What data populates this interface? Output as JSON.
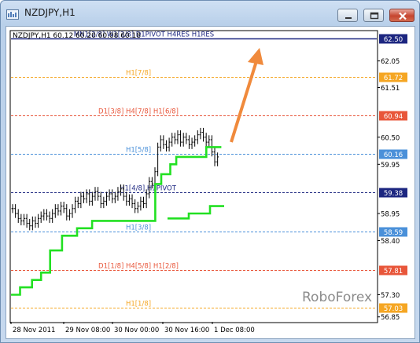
{
  "window": {
    "title": "NZDJPY,H1",
    "icon": "chart-bars-icon",
    "controls": [
      "minimize-icon",
      "maximize-icon",
      "close-icon"
    ]
  },
  "chart": {
    "info_line": "NZDJPY,H1  60.12 60.20 60.08 60.18",
    "watermark": "RoboForex",
    "y_ticks": [
      "62.05",
      "61.51",
      "60.50",
      "59.95",
      "58.95",
      "58.40",
      "57.30",
      "56.85"
    ],
    "x_ticks": [
      "28 Nov 2011",
      "29 Nov 08:00",
      "30 Nov 00:00",
      "30 Nov 16:00",
      "1 Dec 08:00"
    ]
  },
  "colors": {
    "orange_level": "#f5a623",
    "red_level": "#e8563a",
    "blue_level": "#4a90d9",
    "navy_level": "#1c2680",
    "indicator_line": "#22e022",
    "arrow": "#f08a3c"
  },
  "chart_data": {
    "type": "line",
    "title": "",
    "xlabel": "",
    "ylabel": "",
    "ylim": [
      56.75,
      62.65
    ],
    "x": [
      "28 Nov 2011",
      "29 Nov 08:00",
      "30 Nov 00:00",
      "30 Nov 16:00",
      "1 Dec 08:00"
    ],
    "levels": [
      {
        "label": "MN1[2/8] W1[2/8] D1PIVOT H4RES H1RES",
        "value": 62.5,
        "price_label": "62.50",
        "color": "#1c2680",
        "style": "solid"
      },
      {
        "label": "H1[7/8]",
        "value": 61.72,
        "price_label": "61.72",
        "color": "#f5a623",
        "style": "dashed"
      },
      {
        "label": "D1[3/8] H4[7/8] H1[6/8]",
        "value": 60.94,
        "price_label": "60.94",
        "color": "#e8563a",
        "style": "dashed"
      },
      {
        "label": "H1[5/8]",
        "value": 60.16,
        "price_label": "60.16",
        "color": "#4a90d9",
        "style": "dashed"
      },
      {
        "label": "H1[4/8] H1PIVOT",
        "value": 59.38,
        "price_label": "59.38",
        "color": "#1c2680",
        "style": "dashed"
      },
      {
        "label": "H1[3/8]",
        "value": 58.59,
        "price_label": "58.59",
        "color": "#4a90d9",
        "style": "dashed"
      },
      {
        "label": "D1[1/8] H4[5/8] H1[2/8]",
        "value": 57.81,
        "price_label": "57.81",
        "color": "#e8563a",
        "style": "dashed"
      },
      {
        "label": "H1[1/8]",
        "value": 57.03,
        "price_label": "57.03",
        "color": "#f5a623",
        "style": "dashed"
      }
    ],
    "series": [
      {
        "kind": "price_bars",
        "values": [
          59.05,
          58.95,
          58.85,
          58.8,
          58.85,
          58.75,
          58.7,
          58.8,
          58.75,
          58.85,
          58.9,
          58.95,
          58.9,
          58.85,
          58.95,
          59.05,
          59.0,
          59.1,
          59.05,
          58.9,
          58.95,
          59.05,
          59.2,
          59.15,
          59.3,
          59.25,
          59.35,
          59.2,
          59.3,
          59.4,
          59.3,
          59.15,
          59.2,
          59.3,
          59.35,
          59.25,
          59.3,
          59.4,
          59.45,
          59.3,
          59.2,
          59.25,
          59.15,
          59.05,
          59.1,
          59.2,
          59.15,
          59.35,
          59.6,
          59.55,
          59.8,
          60.3,
          60.45,
          60.35,
          60.3,
          60.4,
          60.5,
          60.45,
          60.55,
          60.4,
          60.5,
          60.45,
          60.35,
          60.4,
          60.45,
          60.55,
          60.6,
          60.5,
          60.4,
          60.45,
          60.2,
          60.0,
          60.1
        ]
      },
      {
        "kind": "trailing_stop",
        "values": [
          57.3,
          57.3,
          57.3,
          57.45,
          57.45,
          57.45,
          57.45,
          57.6,
          57.6,
          57.6,
          57.75,
          57.75,
          57.75,
          58.2,
          58.2,
          58.2,
          58.2,
          58.5,
          58.5,
          58.5,
          58.5,
          58.5,
          58.65,
          58.65,
          58.65,
          58.65,
          58.65,
          58.8,
          58.8,
          58.8,
          58.8,
          58.8,
          58.8,
          58.8,
          58.8,
          58.8,
          58.8,
          58.8,
          58.8,
          58.8,
          58.8,
          58.8,
          58.8,
          58.8,
          58.8,
          58.8,
          58.8,
          58.8,
          59.55,
          59.55,
          59.75,
          59.75,
          59.75,
          59.95,
          59.95,
          60.1,
          60.1,
          60.1,
          60.1,
          60.1,
          60.1,
          60.1,
          60.1,
          60.1,
          60.1,
          60.3,
          60.3,
          60.3,
          60.3,
          60.3
        ]
      },
      {
        "kind": "trailing_stop_lower",
        "values": [
          58.85,
          58.85,
          58.85,
          58.95,
          58.95,
          58.95,
          59.1,
          59.1
        ]
      }
    ]
  }
}
